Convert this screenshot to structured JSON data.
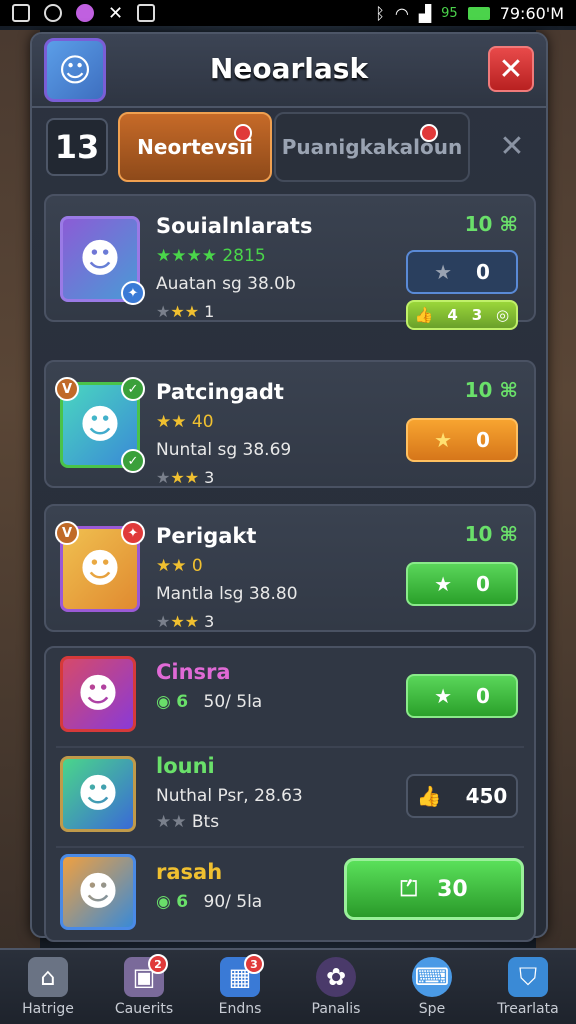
{
  "status_bar": {
    "battery_label": "95",
    "time": "79:60'M"
  },
  "header": {
    "title": "Neoarlask",
    "close_icon": "close-icon"
  },
  "tabs": {
    "count": "13",
    "active_label": "Neortevsii",
    "inactive_label": "Puanigkakaloun"
  },
  "cards": [
    {
      "name": "Souialnlarats",
      "line2": "Auatan sg 38.0b",
      "stars_line1": "★★★★ 2815",
      "line3_count": "1",
      "reward": "10 ⌘",
      "button_value": "0",
      "pill_left": "4",
      "pill_right": "3",
      "button_style": "blue"
    },
    {
      "name": "Patcingadt",
      "stars_line1": "★★ 40",
      "line2": "Nuntal sg 38.69",
      "line3_count": "3",
      "reward": "10 ⌘",
      "button_value": "0",
      "button_style": "orange"
    },
    {
      "name": "Perigakt",
      "stars_line1": "★★ 0",
      "line2": "Mantla lsg 38.80",
      "line3_count": "3",
      "reward": "10 ⌘",
      "button_value": "0",
      "button_style": "green"
    },
    {
      "name": "Cinsra",
      "line2_left": "6",
      "line2_right": "50/ 5la",
      "button_value": "0",
      "button_style": "green"
    },
    {
      "name": "louni",
      "line2": "Nuthal Psr, 28.63",
      "line3": "Bts",
      "button_value": "450",
      "button_style": "dark"
    },
    {
      "name": "rasah",
      "line2_left": "6",
      "line2_right": "90/ 5la",
      "button_value": "30",
      "button_style": "big-green"
    }
  ],
  "nav": [
    {
      "label": "Hatrige",
      "icon": "home-icon"
    },
    {
      "label": "Cauerits",
      "icon": "box-icon",
      "badge": "2"
    },
    {
      "label": "Endns",
      "icon": "map-icon",
      "badge": "3"
    },
    {
      "label": "Panalis",
      "icon": "badge-icon"
    },
    {
      "label": "Spe",
      "icon": "keyboard-icon"
    },
    {
      "label": "Trearlata",
      "icon": "shield-icon"
    }
  ]
}
